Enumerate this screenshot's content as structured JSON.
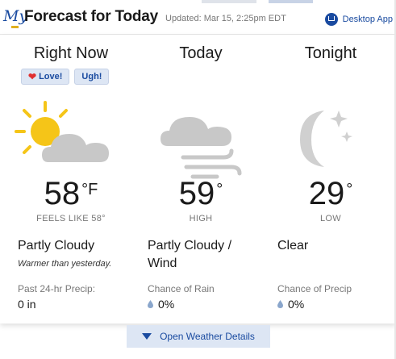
{
  "header": {
    "logo_text": "My",
    "title": "Forecast for Today",
    "updated": "Updated: Mar 15, 2:25pm EDT",
    "desktop_app": "Desktop App"
  },
  "columns": [
    {
      "heading": "Right Now",
      "icon": "partly-cloudy-icon",
      "temp": "58",
      "unit": "°F",
      "sub": "FEELS LIKE 58°",
      "condition": "Partly Cloudy",
      "note": "Warmer than yesterday.",
      "precip_label": "Past 24-hr Precip:",
      "precip_value": "0 in"
    },
    {
      "heading": "Today",
      "icon": "cloudy-wind-icon",
      "temp": "59",
      "unit": "°",
      "sub": "HIGH",
      "condition": "Partly Cloudy / Wind",
      "precip_label": "Chance of Rain",
      "precip_value": "0%"
    },
    {
      "heading": "Tonight",
      "icon": "moon-stars-icon",
      "temp": "29",
      "unit": "°",
      "sub": "LOW",
      "condition": "Clear",
      "precip_label": "Chance of Precip",
      "precip_value": "0%"
    }
  ],
  "rating": {
    "love": "Love!",
    "ugh": "Ugh!"
  },
  "details_button": "Open Weather Details",
  "colors": {
    "accent": "#1a4ba0",
    "sun": "#f5c518",
    "cloud": "#c8c8c8",
    "moon": "#d0d0d0"
  }
}
